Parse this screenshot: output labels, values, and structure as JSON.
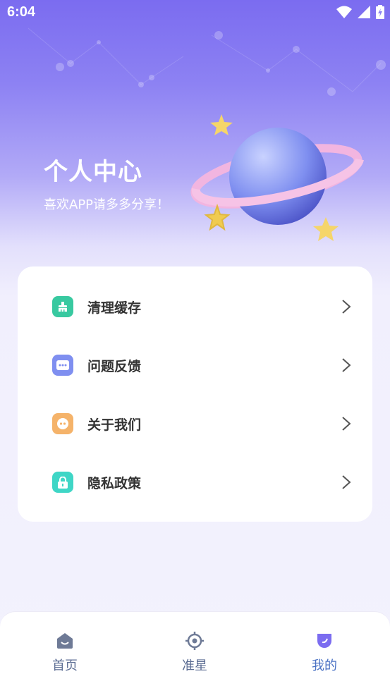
{
  "status_bar": {
    "time": "6:04"
  },
  "header": {
    "title": "个人中心",
    "subtitle": "喜欢APP请多多分享！"
  },
  "menu": {
    "items": [
      {
        "label": "清理缓存",
        "icon": "broom-icon",
        "color": "#38c9a0"
      },
      {
        "label": "问题反馈",
        "icon": "chat-icon",
        "color": "#7f8ff0"
      },
      {
        "label": "关于我们",
        "icon": "info-icon",
        "color": "#f5b36a"
      },
      {
        "label": "隐私政策",
        "icon": "lock-icon",
        "color": "#3fd6c6"
      }
    ]
  },
  "tab_bar": {
    "tabs": [
      {
        "label": "首页",
        "icon": "home-icon",
        "active": false
      },
      {
        "label": "准星",
        "icon": "crosshair-icon",
        "active": false
      },
      {
        "label": "我的",
        "icon": "profile-icon",
        "active": true
      }
    ]
  },
  "colors": {
    "accent": "#7b6cf0",
    "tab_active": "#4b72c4",
    "tab_inactive": "#5d6e94"
  }
}
